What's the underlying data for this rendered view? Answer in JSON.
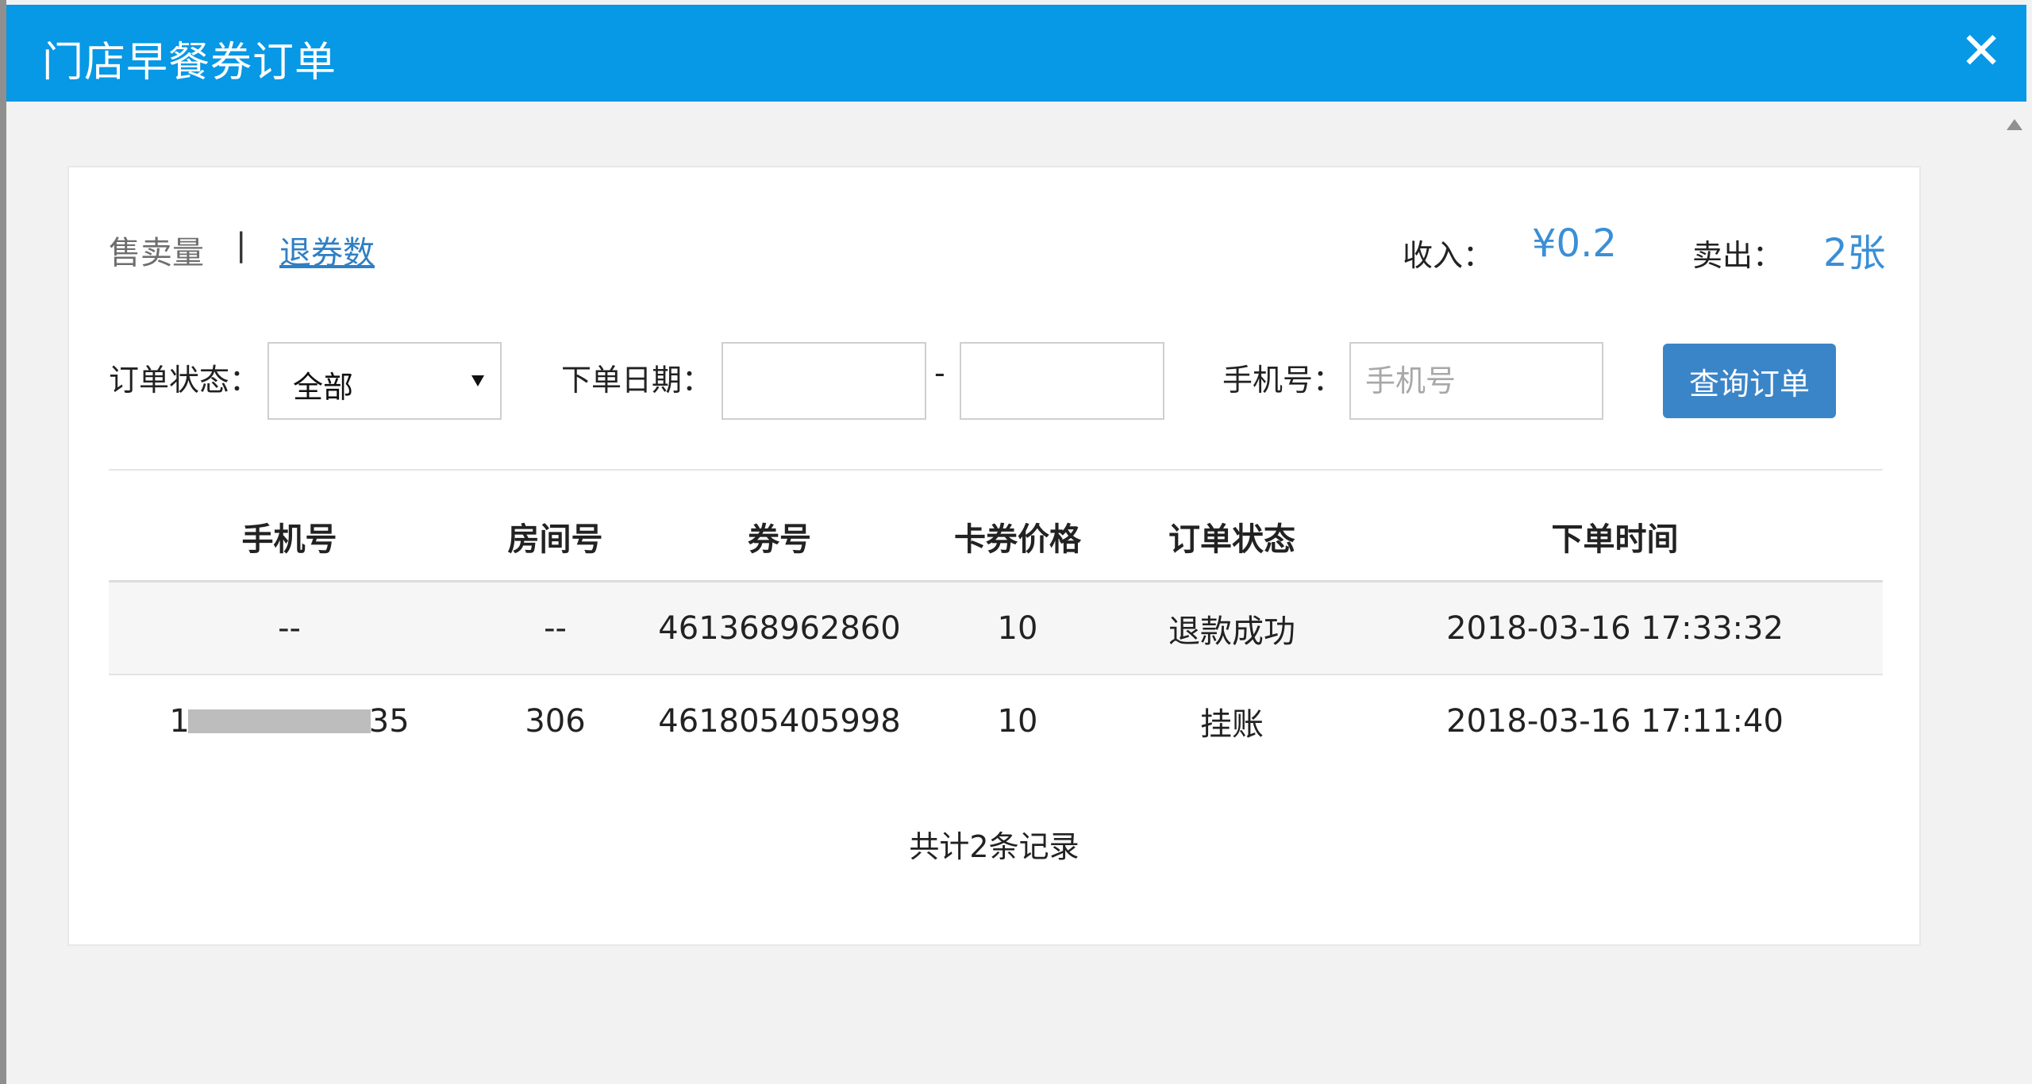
{
  "modal": {
    "title": "门店早餐券订单",
    "close_icon": "close-icon"
  },
  "tabs": {
    "sales_label": "售卖量",
    "separator": "|",
    "refunds_label": "退券数"
  },
  "stats": {
    "income_label": "收入：",
    "income_value": "¥0.2",
    "sold_label": "卖出：",
    "sold_value": "2张"
  },
  "filters": {
    "status_label": "订单状态：",
    "status_value": "全部",
    "date_label": "下单日期：",
    "date_start_value": "",
    "date_separator": "-",
    "date_end_value": "",
    "phone_label": "手机号：",
    "phone_placeholder": "手机号",
    "query_button": "查询订单"
  },
  "table": {
    "headers": [
      "手机号",
      "房间号",
      "券号",
      "卡券价格",
      "订单状态",
      "下单时间"
    ],
    "rows": [
      {
        "phone": "--",
        "room": "--",
        "coupon": "461368962860",
        "price": "10",
        "status": "退款成功",
        "time": "2018-03-16 17:33:32"
      },
      {
        "phone_prefix": "1",
        "phone_suffix": "35",
        "room": "306",
        "coupon": "461805405998",
        "price": "10",
        "status": "挂账",
        "time": "2018-03-16 17:11:40"
      }
    ]
  },
  "footer": {
    "record_count": "共计2条记录"
  },
  "colors": {
    "title_bar": "#0798e6",
    "accent_value": "#3a8fd6",
    "button": "#3a85c8"
  }
}
